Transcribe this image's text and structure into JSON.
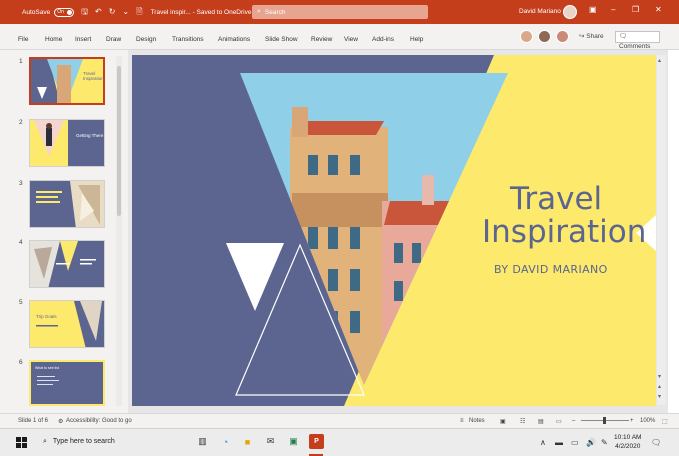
{
  "titlebar": {
    "autosave_label": "AutoSave",
    "autosave_state": "On",
    "document": "Travel inspir... - Saved to OneDrive",
    "search_placeholder": "Search",
    "user_name": "David Mariano"
  },
  "ribbon": {
    "tabs": [
      "File",
      "Home",
      "Insert",
      "Draw",
      "Design",
      "Transitions",
      "Animations",
      "Slide Show",
      "Review",
      "View",
      "Add-ins",
      "Help"
    ],
    "share_label": "Share",
    "comments_label": "Comments"
  },
  "thumbnails": {
    "numbers": [
      "1",
      "2",
      "3",
      "4",
      "5",
      "6"
    ],
    "slide1_title": "Travel Inspiration",
    "slide2_title": "Getting There",
    "slide5_title": "Trip Goals",
    "slide6_title": "What to see list"
  },
  "slide": {
    "title_line1": "Travel",
    "title_line2": "Inspiration",
    "subtitle": "BY DAVID MARIANO"
  },
  "statusbar": {
    "slide_info": "Slide 1 of 6",
    "accessibility": "Accessibility: Good to go",
    "notes": "Notes",
    "zoom": "100%"
  },
  "taskbar": {
    "search_placeholder": "Type here to search",
    "time": "10:10 AM",
    "date": "4/2/2020"
  },
  "colors": {
    "brand": "#c43e1c",
    "slate": "#5b6590",
    "yellow": "#fde96b",
    "sky": "#8fcfe8"
  },
  "icons": [
    "save-icon",
    "undo-icon",
    "redo-icon",
    "search-icon",
    "minimize-icon",
    "maximize-icon",
    "close-icon",
    "share-icon",
    "comment-icon",
    "windows-logo-icon"
  ]
}
